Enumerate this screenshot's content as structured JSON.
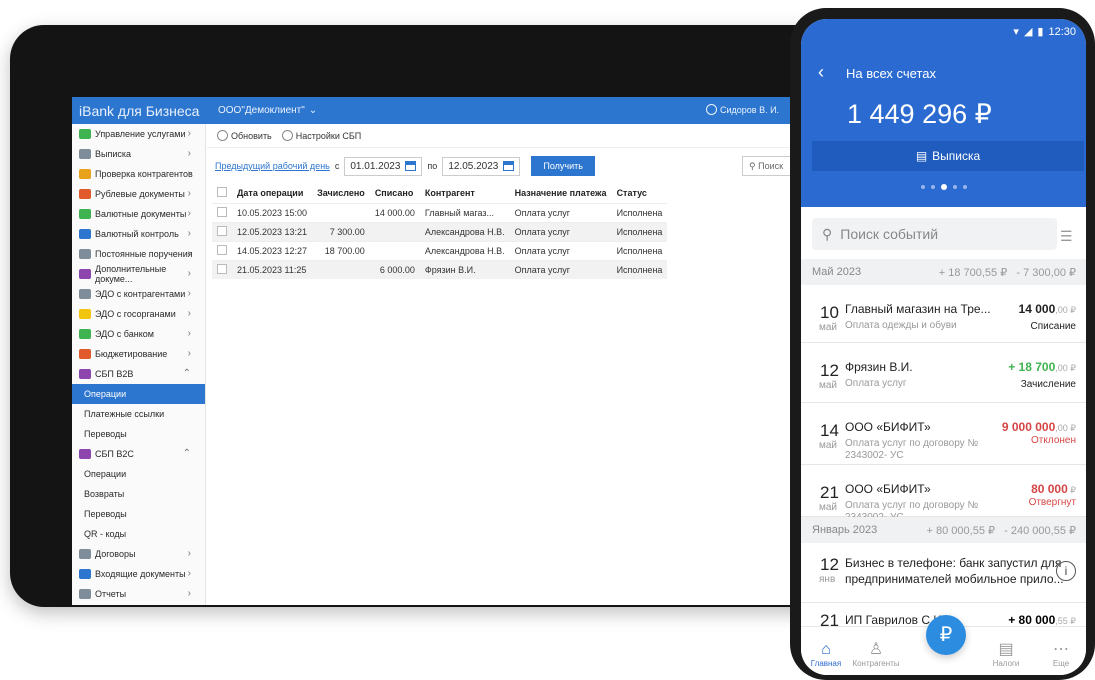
{
  "app": {
    "brand": "iBank для Бизнеса",
    "org": "ООО\"Демоклиент\"",
    "user": "Сидоров В. И."
  },
  "sidebar": {
    "items": [
      {
        "label": "Управление услугами",
        "icon": "toggle-icon",
        "color": "#3fb34f"
      },
      {
        "label": "Выписка",
        "icon": "statement-icon",
        "color": "#7f8c99"
      },
      {
        "label": "Проверка контрагентов",
        "icon": "check-icon",
        "color": "#e8a21b"
      },
      {
        "label": "Рублевые документы",
        "icon": "ruble-docs-icon",
        "color": "#e05a2b"
      },
      {
        "label": "Валютные документы",
        "icon": "currency-docs-icon",
        "color": "#3fb34f"
      },
      {
        "label": "Валютный контроль",
        "icon": "currency-control-icon",
        "color": "#2d76cf"
      },
      {
        "label": "Постоянные поручения",
        "icon": "standing-orders-icon",
        "color": "#7f8c99"
      },
      {
        "label": "Дополнительные докуме...",
        "icon": "extra-docs-icon",
        "color": "#8e44ad"
      },
      {
        "label": "ЭДО с контрагентами",
        "icon": "edo-icon",
        "color": "#7f8c99"
      },
      {
        "label": "ЭДО с госорганами",
        "icon": "gov-icon",
        "color": "#f1c40f"
      },
      {
        "label": "ЭДО с банком",
        "icon": "bank-icon",
        "color": "#3fb34f"
      },
      {
        "label": "Бюджетирование",
        "icon": "budget-icon",
        "color": "#e05a2b"
      },
      {
        "label": "СБП B2B",
        "icon": "sbp-icon",
        "color": "#8e44ad"
      }
    ],
    "sbp_b2b_sub": [
      "Операции",
      "Платежные ссылки",
      "Переводы"
    ],
    "sbp_b2c": {
      "label": "СБП B2C",
      "icon": "sbp-icon",
      "color": "#8e44ad"
    },
    "sbp_b2c_sub": [
      "Операции",
      "Возвраты",
      "Переводы",
      "QR - коды"
    ],
    "tail": [
      {
        "label": "Договоры",
        "icon": "contracts-icon",
        "color": "#7f8c99"
      },
      {
        "label": "Входящие документы",
        "icon": "incoming-icon",
        "color": "#2d76cf"
      },
      {
        "label": "Отчеты",
        "icon": "reports-icon",
        "color": "#7f8c99"
      }
    ]
  },
  "toolbar": {
    "refresh": "Обновить",
    "sbp_settings": "Настройки СБП"
  },
  "filters": {
    "prev_day": "Предыдущий рабочий день",
    "from_label": "с",
    "from": "01.01.2023",
    "to_label": "по",
    "to": "12.05.2023",
    "get": "Получить",
    "search_placeholder": "Поиск"
  },
  "table": {
    "headers": [
      "Дата операции",
      "Зачислено",
      "Списано",
      "Контрагент",
      "Назначение платежа",
      "Статус"
    ],
    "rows": [
      [
        "10.05.2023 15:00",
        "",
        "14 000.00",
        "Главный магаз...",
        "Оплата услуг",
        "Исполнена"
      ],
      [
        "12.05.2023 13:21",
        "7 300.00",
        "",
        "Александрова Н.В.",
        "Оплата услуг",
        "Исполнена"
      ],
      [
        "14.05.2023 12:27",
        "18 700.00",
        "",
        "Александрова Н.В.",
        "Оплата услуг",
        "Исполнена"
      ],
      [
        "21.05.2023 11:25",
        "",
        "6 000.00",
        "Фрязин В.И.",
        "Оплата услуг",
        "Исполнена"
      ]
    ]
  },
  "phone": {
    "time": "12:30",
    "title": "На всех счетах",
    "balance": "1 449 296 ₽",
    "statement": "Выписка",
    "search_placeholder": "Поиск событий",
    "months": [
      {
        "name": "Май 2023",
        "plus": "+ 18 700,55 ₽",
        "minus": "- 7 300,00 ₽"
      },
      {
        "name": "Январь 2023",
        "plus": "+ 80 000,55 ₽",
        "minus": "- 240 000,55 ₽"
      }
    ],
    "tx": [
      {
        "day": "10",
        "mon": "май",
        "name": "Главный магазин на Тре...",
        "desc": "Оплата одежды и обуви",
        "amt": "14 000",
        "cents": ",00 ₽",
        "state": "Списание",
        "amt_color": "#222222",
        "state_color": "#222222"
      },
      {
        "day": "12",
        "mon": "май",
        "name": "Фрязин В.И.",
        "desc": "Оплата услуг",
        "amt": "+ 18 700",
        "cents": ",00 ₽",
        "state": "Зачисление",
        "amt_color": "#3fb34f",
        "state_color": "#222222"
      },
      {
        "day": "14",
        "mon": "май",
        "name": "ООО «БИФИТ»",
        "desc": "Оплата услуг по договору № 2343002- УС",
        "amt": "9 000 000",
        "cents": ",00 ₽",
        "state": "Отклонен",
        "amt_color": "#d64545",
        "state_color": "#d64545"
      },
      {
        "day": "21",
        "mon": "май",
        "name": "ООО «БИФИТ»",
        "desc": "Оплата услуг по договору № 2343002- УС",
        "amt": "80 000",
        "cents": " ₽",
        "state": "Отвергнут",
        "amt_color": "#d64545",
        "state_color": "#d64545"
      }
    ],
    "news": {
      "day": "12",
      "mon": "янв",
      "text": "Бизнес в телефоне: банк запустил для предпринимателей мобильное прило..."
    },
    "last": {
      "day": "21",
      "name": "ИП Гаврилов С.И.",
      "amt": "+ 80 000",
      "cents": ",55 ₽"
    },
    "tabs": [
      "Главная",
      "Контрагенты",
      "Налоги",
      "Еще"
    ]
  }
}
